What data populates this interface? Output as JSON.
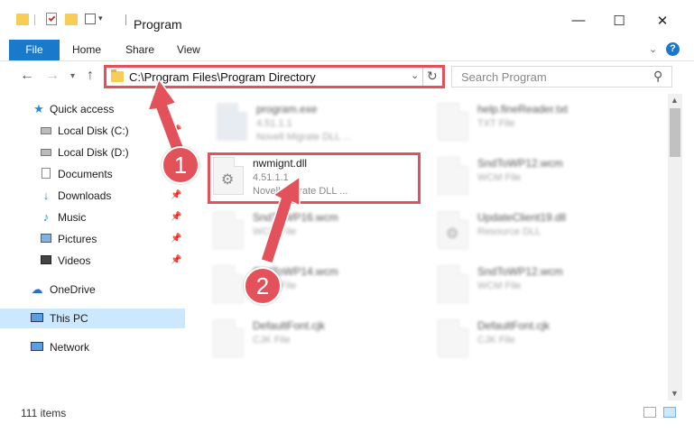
{
  "window": {
    "title": "Program",
    "minimize_label": "—",
    "maximize_label": "☐",
    "close_label": "✕"
  },
  "ribbon": {
    "file": "File",
    "tabs": [
      "Home",
      "Share",
      "View"
    ]
  },
  "nav": {
    "address": "C:\\Program Files\\Program Directory",
    "search_placeholder": "Search Program"
  },
  "sidebar": {
    "items": [
      {
        "label": "Quick access",
        "icon": "star-icon"
      },
      {
        "label": "Local Disk (C:)",
        "icon": "drive-icon"
      },
      {
        "label": "Local Disk (D:)",
        "icon": "drive-icon"
      },
      {
        "label": "Documents",
        "icon": "documents-icon"
      },
      {
        "label": "Downloads",
        "icon": "downloads-icon"
      },
      {
        "label": "Music",
        "icon": "music-icon"
      },
      {
        "label": "Pictures",
        "icon": "pictures-icon"
      },
      {
        "label": "Videos",
        "icon": "videos-icon"
      },
      {
        "label": "OneDrive",
        "icon": "cloud-icon"
      },
      {
        "label": "This PC",
        "icon": "computer-icon"
      },
      {
        "label": "Network",
        "icon": "network-icon"
      }
    ]
  },
  "files": [
    {
      "name": "program.exe",
      "line2": "4.51.1.1",
      "line3": "Novell Migrate DLL ..."
    },
    {
      "name": "help.fineReader.txt",
      "line2": "TXT File",
      "line3": ""
    },
    {
      "name": "nwmignt.dll",
      "line2": "4.51.1.1",
      "line3": "Novell Migrate DLL ..."
    },
    {
      "name": "SndToWP12.wcm",
      "line2": "WCM File",
      "line3": ""
    },
    {
      "name": "SndToWP16.wcm",
      "line2": "WCM File",
      "line3": ""
    },
    {
      "name": "UpdateClient19.dll",
      "line2": "Resource DLL",
      "line3": ""
    },
    {
      "name": "SndToWP14.wcm",
      "line2": "WCM File",
      "line3": ""
    },
    {
      "name": "SndToWP12.wcm",
      "line2": "WCM File",
      "line3": ""
    },
    {
      "name": "DefaultFont.cjk",
      "line2": "CJK File",
      "line3": ""
    },
    {
      "name": "DefaultFont.cjk",
      "line2": "CJK File",
      "line3": ""
    }
  ],
  "status": {
    "count": "111 items"
  },
  "annotations": {
    "step1": "1",
    "step2": "2"
  },
  "colors": {
    "accent": "#1979ca",
    "highlight": "#e3525a",
    "selected": "#cce8ff"
  }
}
